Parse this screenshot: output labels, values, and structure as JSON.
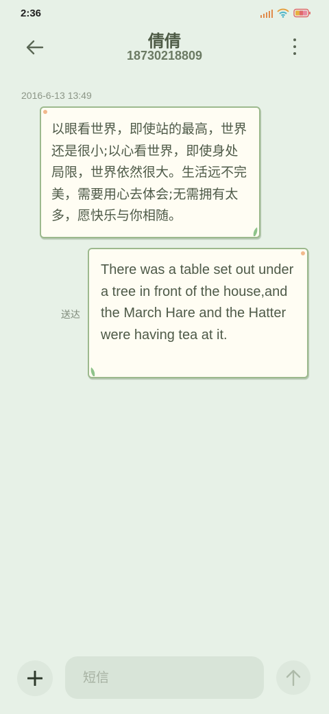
{
  "status_bar": {
    "time": "2:36",
    "icons": [
      "signal-icon",
      "wifi-icon",
      "battery-icon"
    ],
    "signal_color": "#e08a4a",
    "wifi_color": "#e5a040"
  },
  "header": {
    "contact_name": "倩倩",
    "phone_number": "18730218809",
    "back_icon": "back-arrow-icon",
    "more_icon": "more-vertical-icon"
  },
  "conversation": {
    "timestamp": "2016-6-13 13:49",
    "messages": [
      {
        "direction": "incoming",
        "text": "以眼看世界，即使站的最高，世界还是很小;以心看世界，即使身处局限，世界依然很大。生活远不完美，需要用心去体会;无需拥有太多，愿快乐与你相随。"
      },
      {
        "direction": "outgoing",
        "text": "There was a table set out under a tree in front of the house,and the March Hare and the Hatter were having tea at it.",
        "status": "送达"
      }
    ]
  },
  "composer": {
    "placeholder": "短信",
    "value": "",
    "add_icon": "plus-icon",
    "send_icon": "send-arrow-icon"
  },
  "theme": {
    "background": "#e7f1e7",
    "bubble_background": "#fffdf3",
    "bubble_border": "#9cb98d",
    "text_color": "#4e5a48"
  }
}
